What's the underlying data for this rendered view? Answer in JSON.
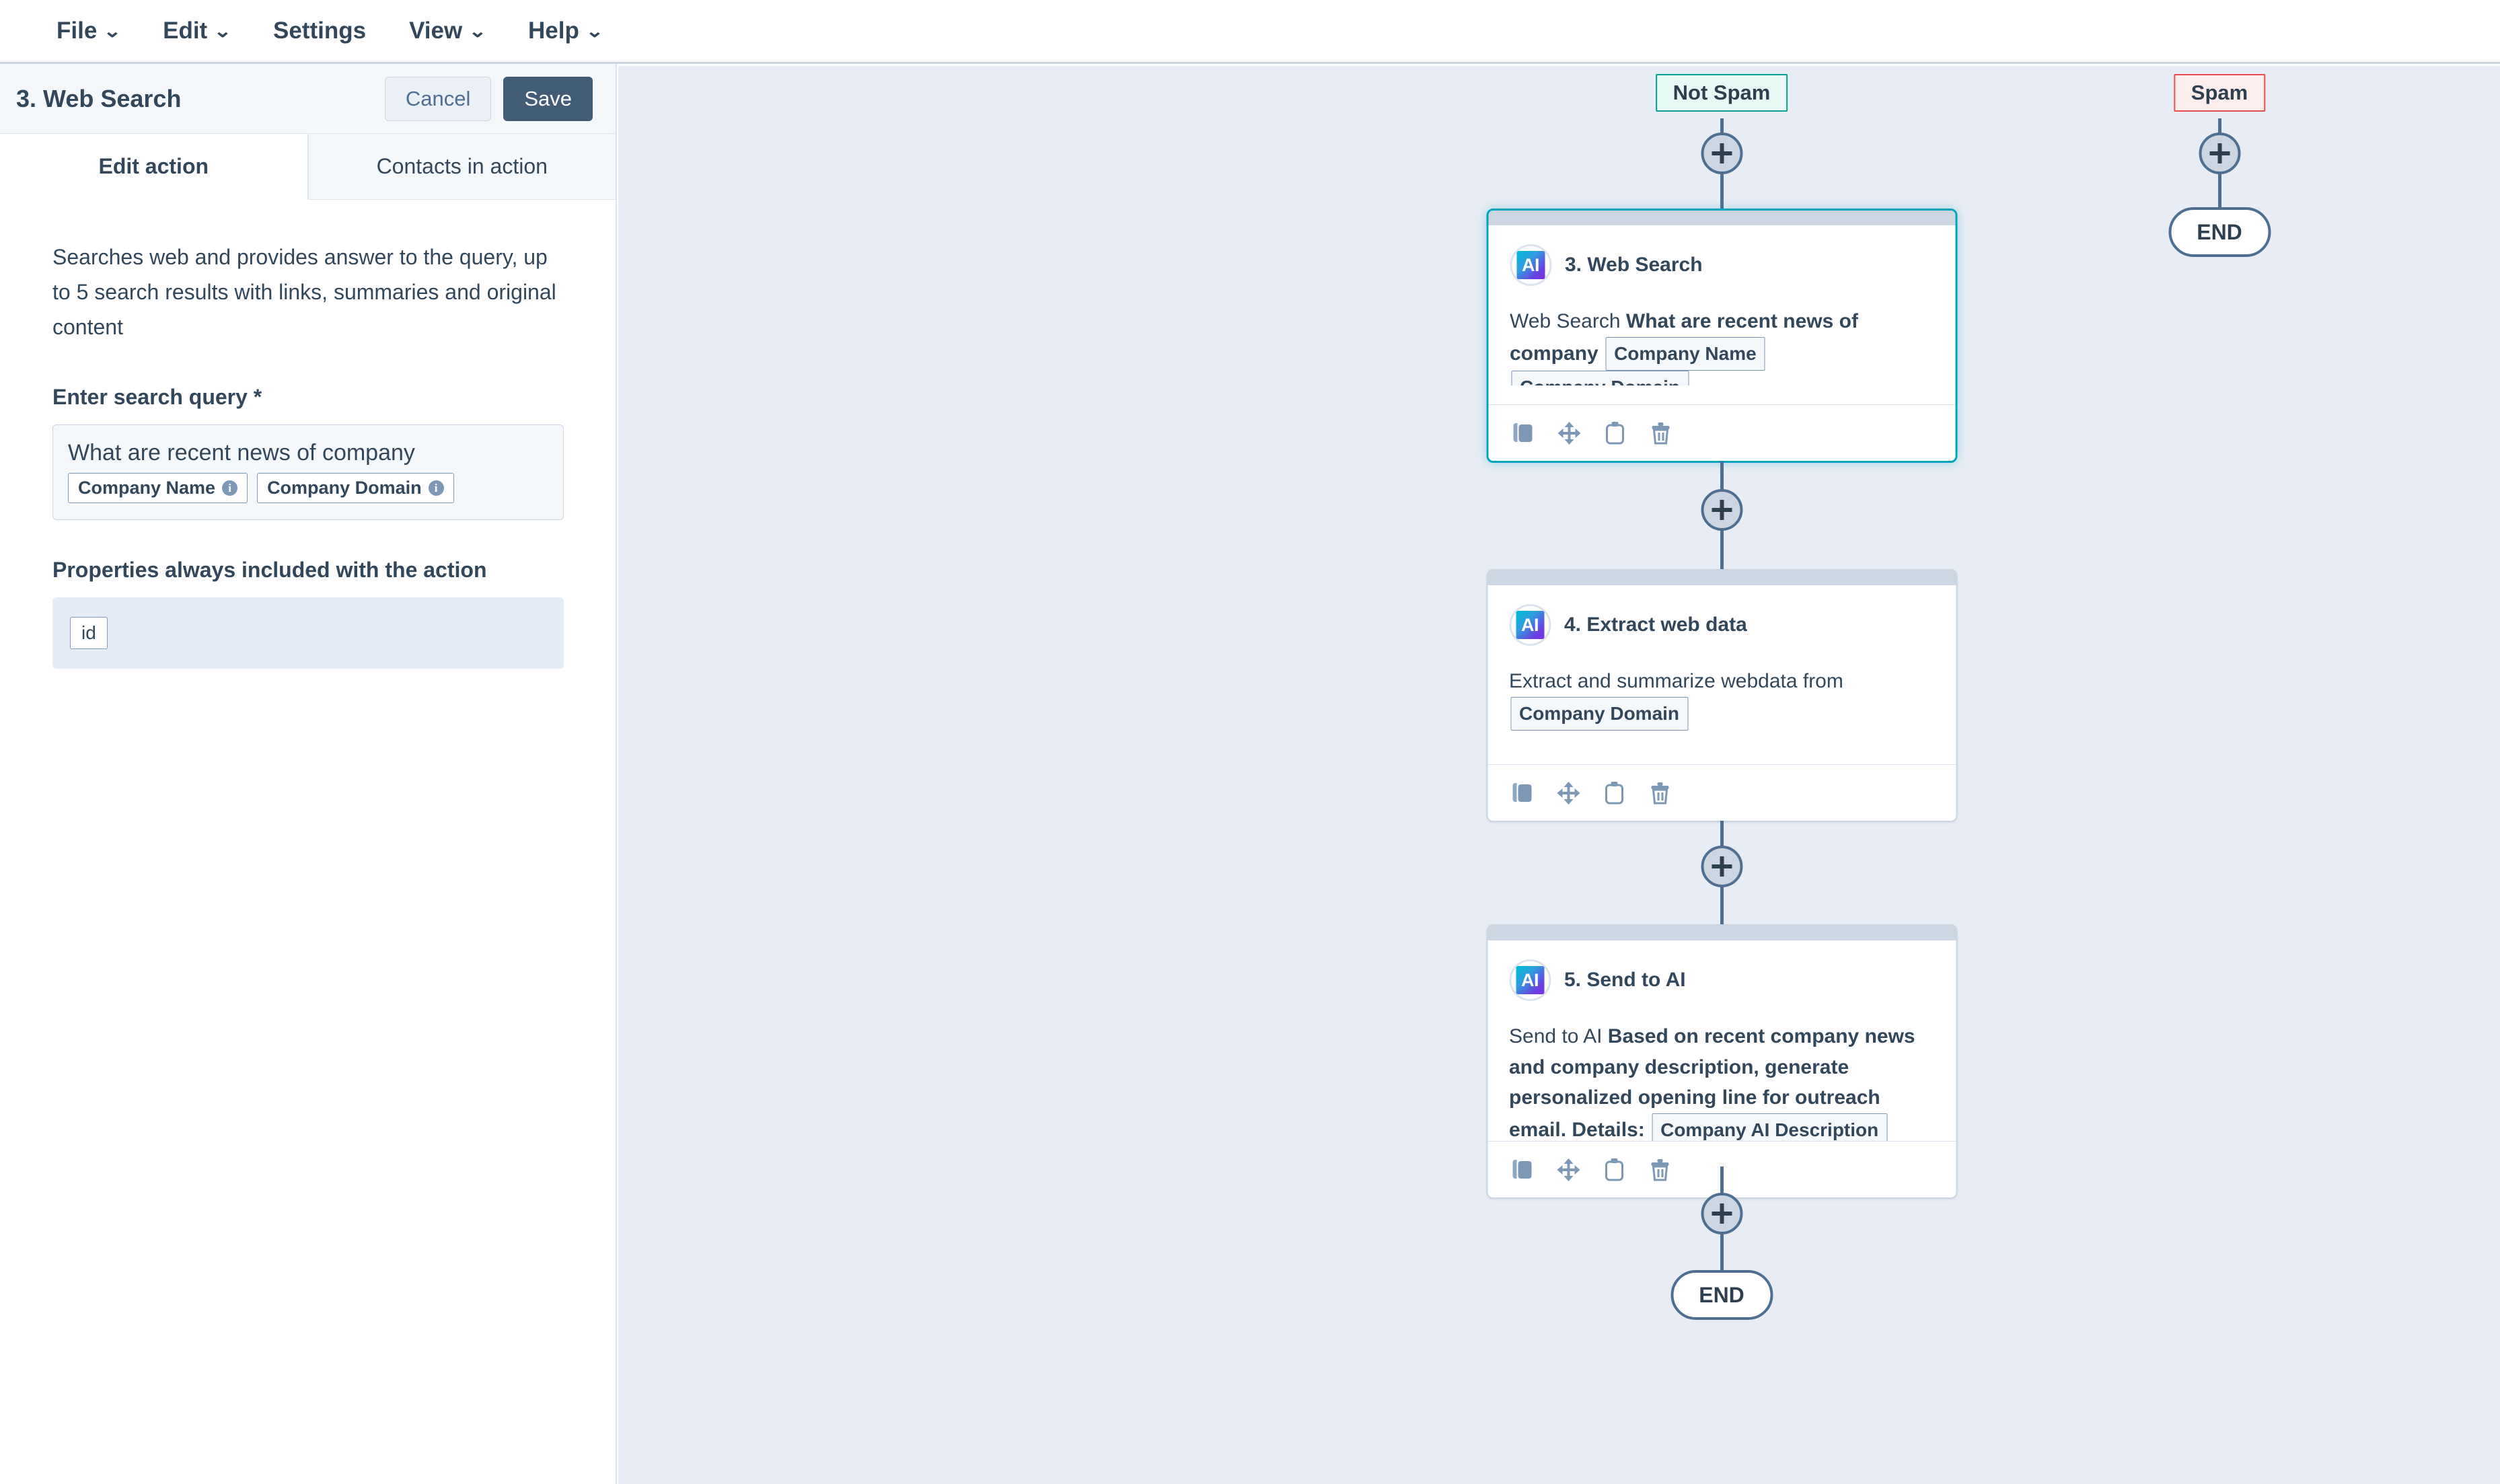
{
  "menubar": {
    "items": [
      {
        "label": "File",
        "caret": true
      },
      {
        "label": "Edit",
        "caret": true
      },
      {
        "label": "Settings",
        "caret": false
      },
      {
        "label": "View",
        "caret": true
      },
      {
        "label": "Help",
        "caret": true
      }
    ]
  },
  "panel": {
    "title": "3. Web Search",
    "cancel_label": "Cancel",
    "save_label": "Save",
    "tabs": [
      {
        "label": "Edit action",
        "active": true
      },
      {
        "label": "Contacts in action",
        "active": false
      }
    ],
    "description": "Searches web and provides answer to the query, up to 5 search results with links, summaries and original content",
    "query_field": {
      "label": "Enter search query *",
      "value": "What are recent news of company",
      "chips": [
        {
          "label": "Company Name",
          "info": "i"
        },
        {
          "label": "Company Domain",
          "info": "i"
        }
      ]
    },
    "properties": {
      "label": "Properties always included with the action",
      "chips": [
        "id"
      ]
    }
  },
  "canvas": {
    "branches": [
      {
        "id": "not-spam",
        "label": "Not Spam",
        "label_border_color": "#00a38d",
        "label_bg_color": "#e8f8f5",
        "end_label": "END"
      },
      {
        "id": "spam",
        "label": "Spam",
        "label_border_color": "#ef4d4d",
        "label_bg_color": "#fdeeee",
        "end_label": "END"
      }
    ],
    "cards": [
      {
        "id": "web-search",
        "badge": "AI",
        "title": "3. Web Search",
        "prefix": "Web Search ",
        "bold_text": "What are recent news of company",
        "tokens": [
          "Company Name",
          "Company Domain"
        ],
        "selected": true
      },
      {
        "id": "extract-web-data",
        "badge": "AI",
        "title": "4. Extract web data",
        "prefix": "Extract and summarize webdata from ",
        "bold_text": "",
        "tokens": [
          "Company Domain"
        ],
        "selected": false
      },
      {
        "id": "send-to-ai",
        "badge": "AI",
        "title": "5. Send to AI",
        "prefix": "Send to AI ",
        "bold_text": "Based on recent company news and company description, generate personalized opening line for outreach email. Details:",
        "tokens": [
          "Company AI Description"
        ],
        "selected": false
      }
    ],
    "card_toolbar_icons": [
      "duplicate-icon",
      "move-icon",
      "clipboard-icon",
      "trash-icon"
    ],
    "add_step_icon": "plus-icon"
  },
  "colors": {
    "accent_selected": "#00a4bd",
    "save_button": "#425b76",
    "canvas_bg": "#e8edf5",
    "connector": "#4e6f92",
    "not_spam": "#00a38d",
    "spam": "#ef4d4d"
  }
}
